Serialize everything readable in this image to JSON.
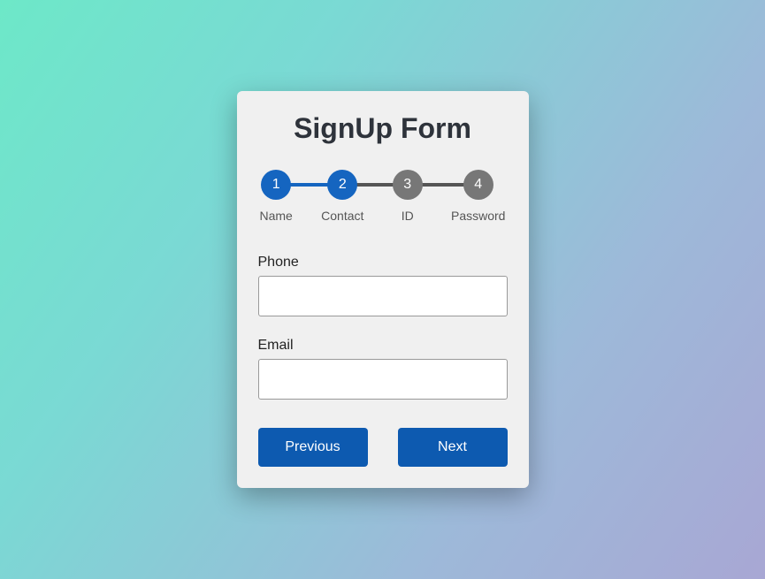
{
  "title": "SignUp Form",
  "steps": [
    {
      "num": "1",
      "label": "Name"
    },
    {
      "num": "2",
      "label": "Contact"
    },
    {
      "num": "3",
      "label": "ID"
    },
    {
      "num": "4",
      "label": "Password"
    }
  ],
  "fields": {
    "phone": {
      "label": "Phone",
      "value": ""
    },
    "email": {
      "label": "Email",
      "value": ""
    }
  },
  "buttons": {
    "prev": "Previous",
    "next": "Next"
  }
}
